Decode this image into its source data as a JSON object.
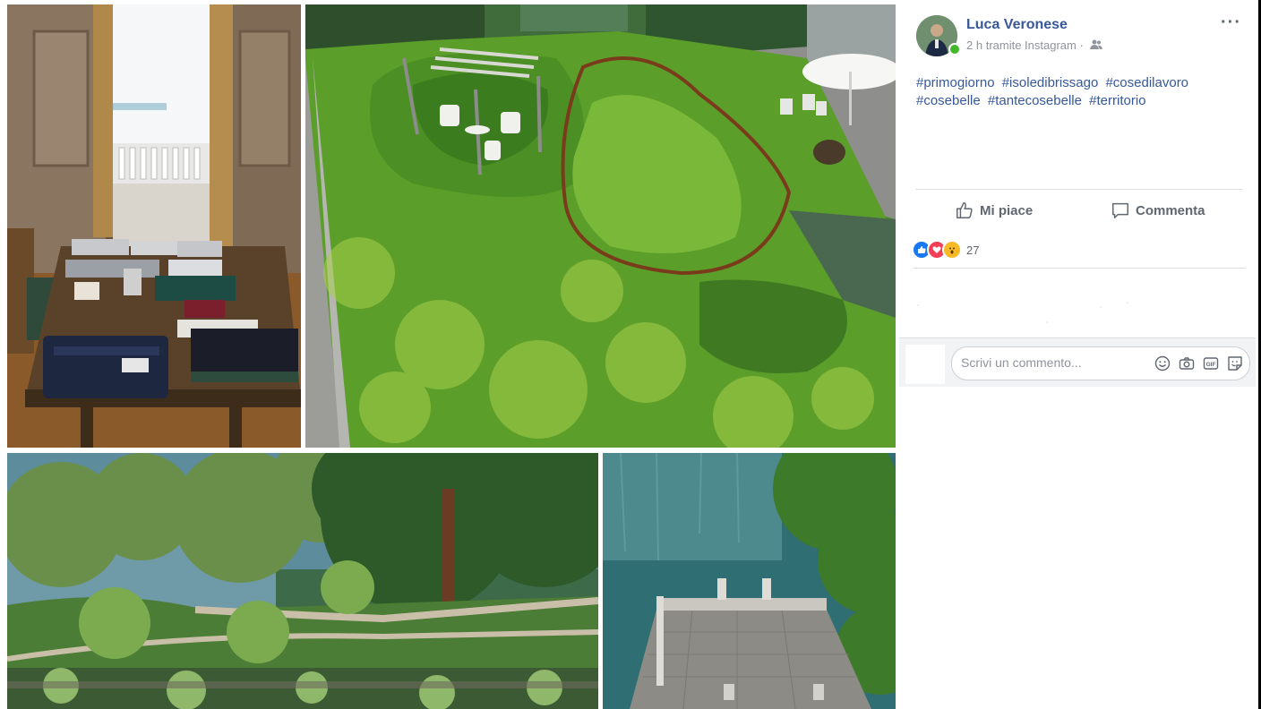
{
  "post": {
    "author": "Luca Veronese",
    "time": "2 h",
    "via": "tramite Instagram",
    "separator": "·",
    "more_label": "···",
    "hashtags": [
      "#primogiorno",
      "#isoledibrissago",
      "#cosedilavoro",
      "#cosebelle",
      "#tantecosebelle",
      "#territorio"
    ]
  },
  "actions": {
    "like_label": "Mi piace",
    "comment_label": "Commenta"
  },
  "reactions": {
    "count": "27",
    "types": [
      "like",
      "love",
      "wow"
    ]
  },
  "comment": {
    "placeholder": "Scrivi un commento...",
    "gif_label": "GIF"
  },
  "icons": {
    "avatar": "profile-photo-icon",
    "audience": "friends-icon",
    "like": "thumbs-up-icon",
    "comment": "speech-bubble-icon",
    "emoji": "smiley-icon",
    "camera": "camera-icon",
    "gif": "gif-icon",
    "sticker": "sticker-icon"
  },
  "colors": {
    "link": "#385898",
    "muted": "#90949c",
    "online": "#42b72a",
    "like_blue": "#1877f2",
    "love_red": "#f33e58",
    "wow_yellow": "#f7b928"
  },
  "photos": [
    {
      "name": "office-desk-photo"
    },
    {
      "name": "rooftop-garden-photo"
    },
    {
      "name": "lakeside-garden-photo"
    },
    {
      "name": "lake-terrace-photo"
    }
  ]
}
